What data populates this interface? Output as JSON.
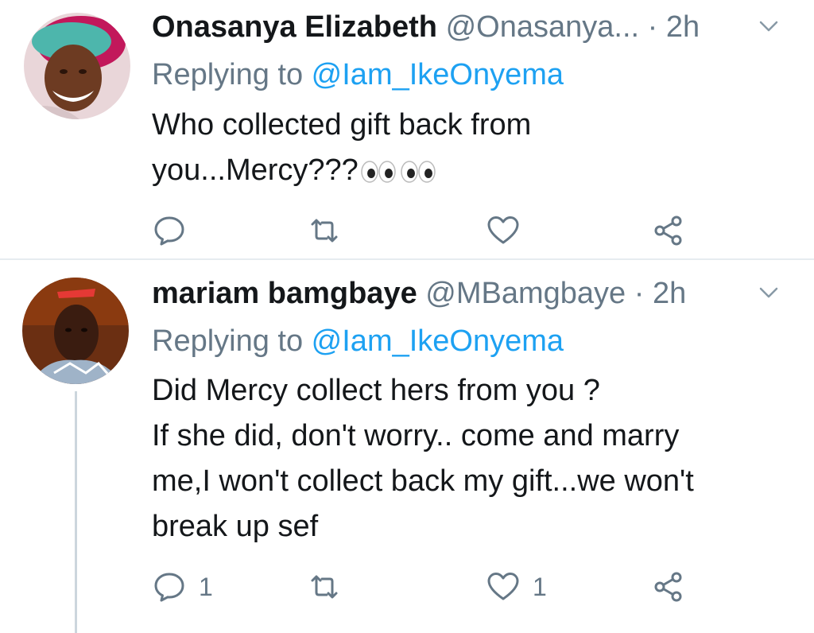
{
  "tweets": [
    {
      "name": "Onasanya Elizabeth",
      "handle": "@Onasanya...",
      "separator": "·",
      "time": "2h",
      "replying_prefix": "Replying to ",
      "replying_handle": "@Iam_IkeOnyema",
      "text_lines": [
        "Who collected gift back from",
        "you...Mercy???"
      ],
      "emoji": "eyes-emoji x2",
      "reply_count": "",
      "retweet_count": "",
      "like_count": ""
    },
    {
      "name": "mariam bamgbaye",
      "handle": "@MBamgbaye",
      "separator": "·",
      "time": "2h",
      "replying_prefix": "Replying to ",
      "replying_handle": "@Iam_IkeOnyema",
      "text_lines": [
        "Did Mercy collect hers from you ?",
        "If she did, don't worry.. come and marry",
        "me,I won't collect back my gift...we won't",
        "break up sef"
      ],
      "reply_count": "1",
      "retweet_count": "",
      "like_count": "1"
    }
  ],
  "icons": {
    "reply": "reply-icon",
    "retweet": "retweet-icon",
    "like": "heart-icon",
    "share": "share-icon",
    "caret": "chevron-down-icon"
  },
  "colors": {
    "text": "#14171a",
    "secondary": "#657786",
    "link": "#1da1f2",
    "divider": "#e6ecf0"
  }
}
